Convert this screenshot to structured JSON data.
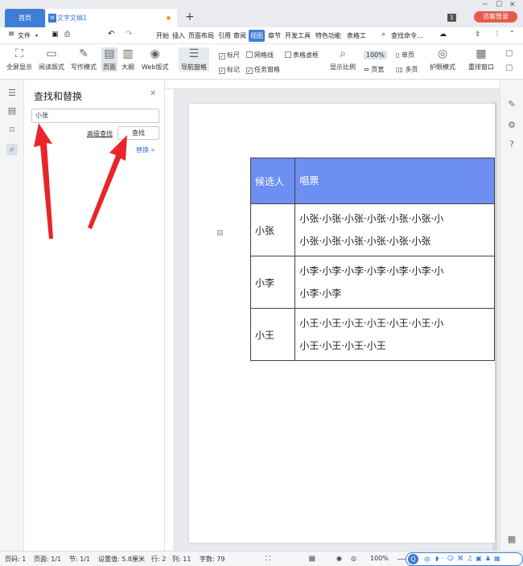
{
  "titlebar": {
    "home_tab": "首页",
    "doc_tab": "文字文稿1",
    "doc_icon": "W",
    "page_badge": "1",
    "login_button": "访客登录"
  },
  "menubar": {
    "file": "文件",
    "items": [
      "开始",
      "插入",
      "页面布局",
      "引用",
      "审阅",
      "视图",
      "章节",
      "开发工具",
      "特色功能",
      "表格工"
    ],
    "active": "视图",
    "search": "查找命令..."
  },
  "ribbon": {
    "fullscreen": "全屏显示",
    "reading": "阅读版式",
    "writing": "写作模式",
    "page": "页面",
    "outline": "大纲",
    "web": "Web版式",
    "nav_pane": "导航窗格",
    "ruler": "标尺",
    "gridlines": "网格线",
    "table_gridlines": "表格虚框",
    "marks": "标记",
    "task_pane": "任务窗格",
    "zoom_label": "显示比例",
    "zoom_value": "100%",
    "page_width": "页宽",
    "single_page": "单页",
    "multi_page": "多页",
    "eye_mode": "护眼模式",
    "rearrange": "重排窗口"
  },
  "panel": {
    "title": "查找和替换",
    "search_value": "小张",
    "advanced": "高级查找",
    "find_button": "查找",
    "replace": "替换"
  },
  "document": {
    "header": [
      "候选人",
      "唱票"
    ],
    "rows": [
      {
        "name": "小张",
        "votes_line1": "小张·小张·小张·小张·小张·小张·小",
        "votes_line2": "小张·小张·小张·小张·小张·小张"
      },
      {
        "name": "小李",
        "votes_line1": "小李·小李·小李·小李·小李·小李·小",
        "votes_line2": "小李·小李"
      },
      {
        "name": "小王",
        "votes_line1": "小王·小王·小王·小王·小王·小王·小",
        "votes_line2": "小王·小王·小王·小王"
      }
    ],
    "header_color": "#6d8ff2"
  },
  "statusbar": {
    "page_no": "页码: 1",
    "pages": "页面: 1/1",
    "section": "节: 1/1",
    "setting": "设置值: 5.8厘米",
    "row": "行: 2",
    "col": "列: 11",
    "words": "字数: 79",
    "zoom": "100%",
    "ime": "中"
  },
  "colors": {
    "accent": "#3f7ed6",
    "login": "#e85a4f",
    "arrow": "#e8262a"
  }
}
